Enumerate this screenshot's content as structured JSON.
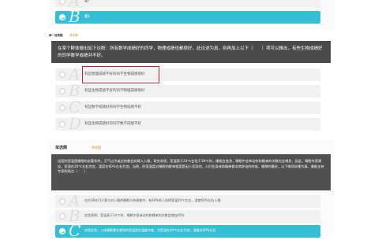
{
  "top_card": {
    "options": [
      {
        "letter": "A",
        "text": "面ⅰ",
        "selected": false
      },
      {
        "letter": "B",
        "text": "面ⅱ",
        "selected": true
      }
    ]
  },
  "mid_card": {
    "breadcrumb": "单一选项题",
    "tag": "常考题",
    "question": "在某个群体做出如下论断：所有数学成绩好的同学，物理成绩也都很好。此论述为真，则再加上以下（　　）项可以推出，有些生物成绩好的同学数学成绩并不好。",
    "options": [
      {
        "letter": "A",
        "text": "有些物理成绩不好的同学生物成绩很好",
        "selected": false
      },
      {
        "letter": "B",
        "text": "有些生物成绩不好的同学物理成绩很好",
        "selected": false
      },
      {
        "letter": "C",
        "text": "有些数学成绩好的同学生物成绩不好",
        "selected": false
      },
      {
        "letter": "D",
        "text": "有些生物成绩好的同学数学成绩不好",
        "selected": false
      }
    ]
  },
  "bottom_card": {
    "section": "单选题",
    "tag": "常考题",
    "question": "适度的室温是睡眠的必要条件。天气过冷或过热都会妨碍入人睡，研究发现，室温高于24℃会低于18℃时，睡眠会变浅，睡眠中会单动作和睡来的次数也会增多，因此，睡眠专家建议，室温在20℃左右为宜，湿度在60%左右为宜，当然，卧室温度对睡眠的影响程度是因人而异的，人们在身体和精神都非常舒适的时候，睡眠的最好，以下哪项如果为真，最能支持专家的观点（　　）",
    "options": [
      {
        "letter": "A",
        "text": "在约38名可介意与对入睡的睡眠与待调查中，有60%的人选择室温20℃左右，湿度60%左右入睡",
        "selected": false
      },
      {
        "letter": "B",
        "text": "实验表明，室温高于24℃时，睡眠中身体动作和睡来的次数会增加20%",
        "selected": false
      },
      {
        "letter": "C",
        "text": "实验证实，入体睡眠最先感觉的室温是在温度中度，为室温在20℃左右为宜，湿度在60%左右",
        "selected": true
      }
    ]
  }
}
